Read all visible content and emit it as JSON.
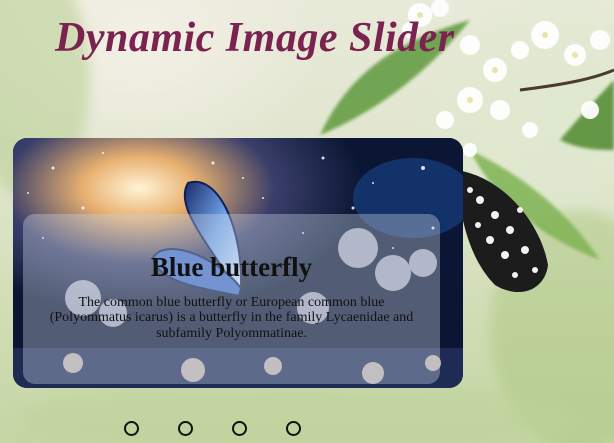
{
  "page": {
    "title": "Dynamic Image Slider"
  },
  "slider": {
    "active_index": 0,
    "slides": [
      {
        "title": "Blue butterfly",
        "description": "The common blue butterfly or European common blue (Polyommatus icarus) is a butterfly in the family Lycaenidae and subfamily Polyommatinae.",
        "image": "blue-butterfly-image"
      }
    ],
    "dots": [
      {
        "label": "slide-1"
      },
      {
        "label": "slide-2"
      },
      {
        "label": "slide-3"
      },
      {
        "label": "slide-4"
      }
    ]
  },
  "colors": {
    "title": "#7a2350",
    "caption_background": "rgba(200,210,225,0.38)",
    "page_green": "#cfdcb2"
  }
}
